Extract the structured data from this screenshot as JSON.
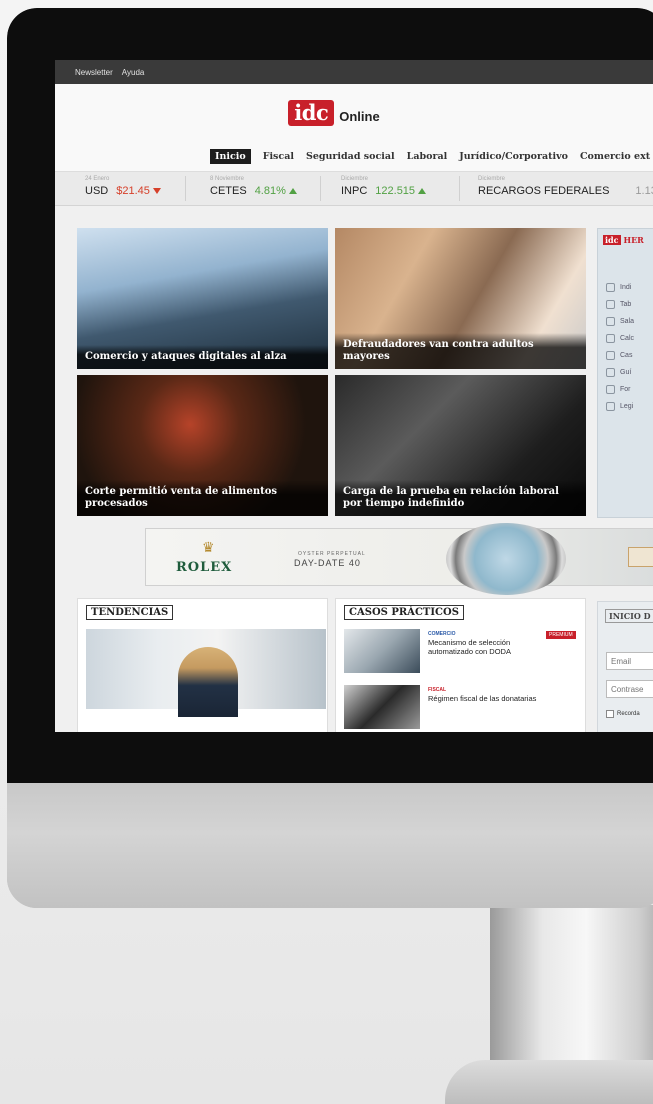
{
  "topbar": {
    "links": [
      "Newsletter",
      "Ayuda"
    ]
  },
  "logo": {
    "mark": "idc",
    "suffix": "Online"
  },
  "nav": {
    "items": [
      "Inicio",
      "Fiscal",
      "Seguridad social",
      "Laboral",
      "Jurídico/Corporativo",
      "Comercio ext"
    ],
    "active": "Inicio"
  },
  "ticker": [
    {
      "date": "24 Enero",
      "name": "USD",
      "value": "$21.45",
      "trend": "down"
    },
    {
      "date": "8 Noviembre",
      "name": "CETES",
      "value": "4.81%",
      "trend": "up"
    },
    {
      "date": "Diciembre",
      "name": "INPC",
      "value": "122.515",
      "trend": "up"
    },
    {
      "date": "Diciembre",
      "name": "RECARGOS FEDERALES",
      "value": "1.13"
    }
  ],
  "features": [
    {
      "caption": "Comercio y ataques digitales al alza"
    },
    {
      "caption": "Defraudadores van contra adultos mayores"
    },
    {
      "caption": "Corte permitió venta de alimentos procesados"
    },
    {
      "caption": "Carga de la prueba en relación laboral por tiempo indefinido"
    }
  ],
  "tools": {
    "title_mark": "idc",
    "title": "HER",
    "items": [
      "Indi",
      "Tab",
      "Sala",
      "Calc",
      "Cas",
      "Guí",
      "For",
      "Legi"
    ]
  },
  "banner": {
    "brand": "ROLEX",
    "line1": "OYSTER PERPETUAL",
    "line2": "DAY-DATE 40"
  },
  "tendencias": {
    "title": "TENDENCIAS"
  },
  "casos": {
    "title": "CASOS PRÁCTICOS",
    "items": [
      {
        "category": "COMERCIO",
        "category_color": "#2b5aa8",
        "text": "Mecanismo de selección automatizado con DODA",
        "badge": "PREMIUM"
      },
      {
        "category": "FISCAL",
        "category_color": "#c8202a",
        "text": "Régimen fiscal de las donatarias"
      }
    ]
  },
  "login": {
    "title": "INICIO D",
    "email_placeholder": "Email",
    "password_placeholder": "Contrase",
    "remember": "Recorda"
  },
  "colors": {
    "brand_red": "#c8202a",
    "up_green": "#52a144",
    "down_red": "#d6402a"
  }
}
